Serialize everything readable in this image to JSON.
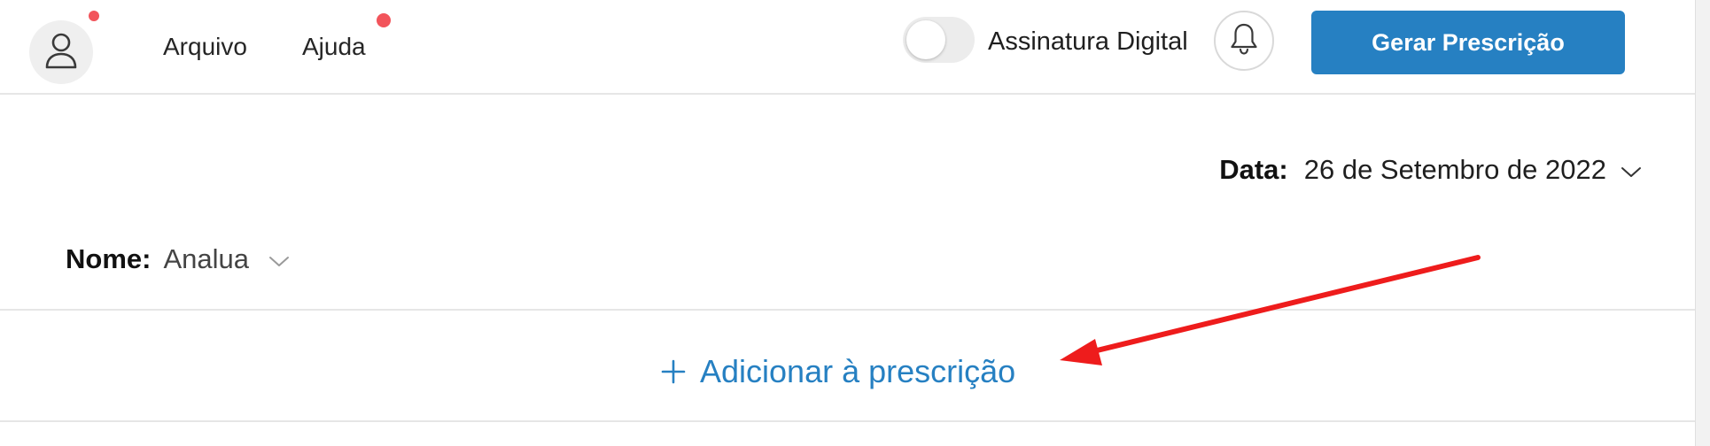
{
  "colors": {
    "accent": "#2680c2",
    "notification_dot": "#f2545b",
    "annotation_arrow": "#ee1c1c"
  },
  "header": {
    "avatar_icon": "user-icon",
    "menu": [
      {
        "label": "Arquivo"
      },
      {
        "label": "Ajuda"
      }
    ],
    "toggle_label": "Assinatura Digital",
    "toggle_on": false,
    "bell_icon": "bell-icon",
    "primary_button_label": "Gerar Prescrição"
  },
  "form": {
    "date_label": "Data:",
    "date_value": "26 de Setembro de 2022",
    "name_label": "Nome:",
    "name_value": "Analua"
  },
  "actions": {
    "add_label": "Adicionar à prescrição"
  }
}
